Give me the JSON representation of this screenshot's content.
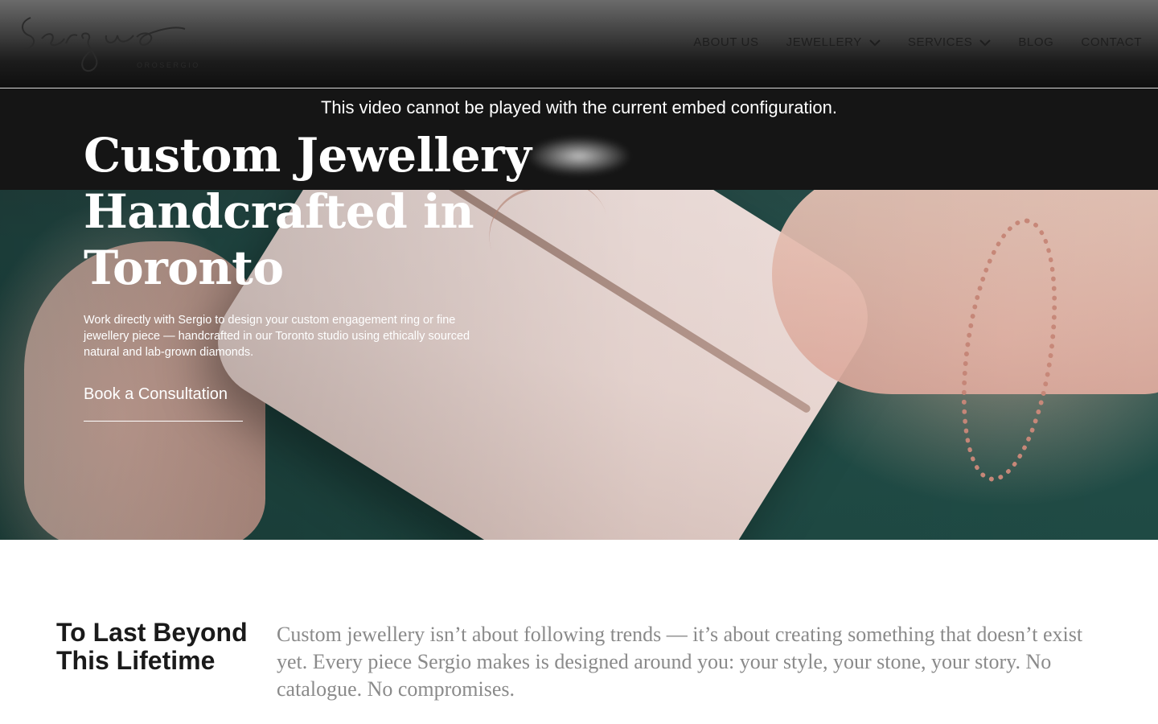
{
  "header": {
    "logo": {
      "script": "Sergio",
      "sub": "OROSERGIO"
    },
    "nav": [
      {
        "label": "ABOUT US",
        "dropdown": false
      },
      {
        "label": "JEWELLERY",
        "dropdown": true
      },
      {
        "label": "SERVICES",
        "dropdown": true
      },
      {
        "label": "BLOG",
        "dropdown": false
      },
      {
        "label": "CONTACT",
        "dropdown": false
      }
    ]
  },
  "video": {
    "error": "This video cannot be played with the current embed configuration."
  },
  "hero": {
    "title": "Custom Jewellery Handcrafted in Toronto",
    "description": "Work directly with Sergio to design your custom engagement ring or fine jewellery piece — handcrafted in our Toronto studio using ethically sourced natural and lab-grown diamonds.",
    "cta": "Book a Consultation"
  },
  "intro": {
    "heading": "To Last Beyond This Lifetime",
    "body": "Custom jewellery isn’t about following trends — it’s about creating something that doesn’t exist yet. Every piece Sergio makes is designed around you: your style, your stone, your story. No catalogue. No compromises."
  },
  "colors": {
    "header_bg": "#1c1c1c",
    "video_error_bg": "#151515",
    "hero_teal": "#24504b",
    "intro_text": "#8a8a8a",
    "heading_text": "#1a1a1a"
  }
}
